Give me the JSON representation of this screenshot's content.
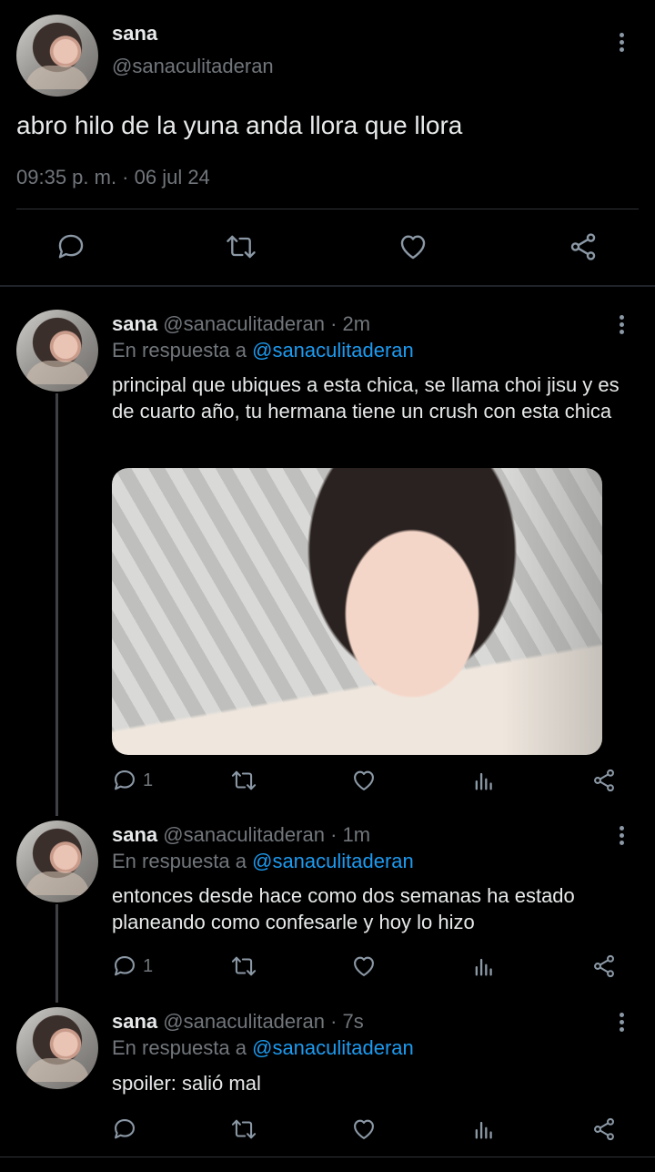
{
  "main_tweet": {
    "name": "sana",
    "handle": "@sanaculitaderan",
    "text": "abro hilo de la yuna anda llora que llora",
    "timestamp": "09:35 p. m. · 06 jul 24",
    "actions": [
      "reply-icon",
      "retweet-icon",
      "like-icon",
      "share-icon"
    ]
  },
  "replies": [
    {
      "name": "sana",
      "handle": "@sanaculitaderan",
      "time": "· 2m",
      "reply_prefix": "En respuesta a",
      "reply_to": "@sanaculitaderan",
      "text": "principal que ubiques a esta chica, se llama choi jisu y es de cuarto año, tu hermana tiene un crush con esta chica",
      "has_image": true,
      "reply_count": "1"
    },
    {
      "name": "sana",
      "handle": "@sanaculitaderan",
      "time": "· 1m",
      "reply_prefix": "En respuesta a",
      "reply_to": "@sanaculitaderan",
      "text": "entonces desde hace como dos semanas ha estado planeando como confesarle y hoy lo hizo",
      "has_image": false,
      "reply_count": "1"
    },
    {
      "name": "sana",
      "handle": "@sanaculitaderan",
      "time": "· 7s",
      "reply_prefix": "En respuesta a",
      "reply_to": "@sanaculitaderan",
      "text": "spoiler: salió mal",
      "has_image": false,
      "reply_count": ""
    }
  ],
  "colors": {
    "background": "#000000",
    "text": "#e7e9ea",
    "muted": "#71767b",
    "mention": "#1d9bf0",
    "divider": "#2f3336"
  }
}
